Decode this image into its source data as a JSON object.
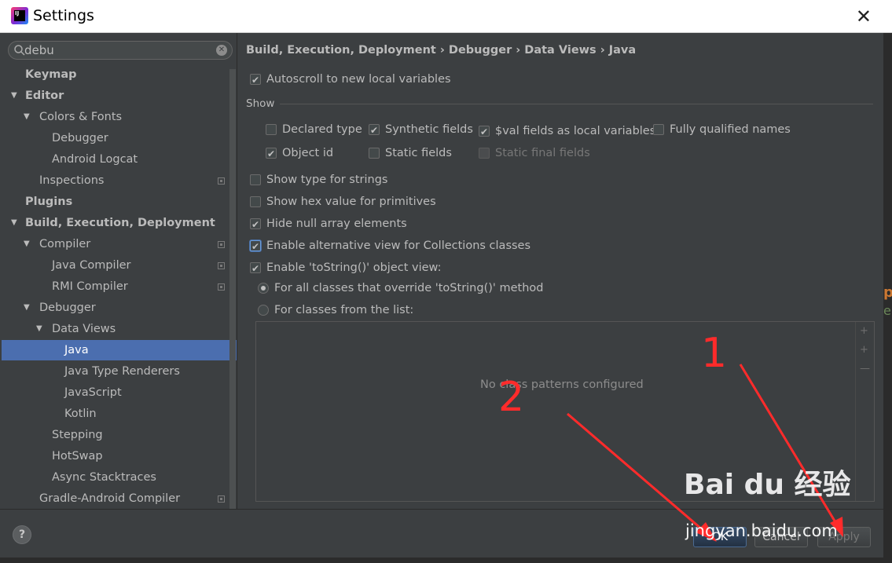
{
  "window": {
    "title": "Settings",
    "close_glyph": "✕",
    "app_icon_text": "IJ"
  },
  "search": {
    "value": "debu"
  },
  "tree": [
    {
      "label": "Keymap",
      "bold": true,
      "arrow": "",
      "level": 0
    },
    {
      "label": "Editor",
      "bold": true,
      "arrow": "▼",
      "level": 0
    },
    {
      "label": "Colors & Fonts",
      "arrow": "▼",
      "level": 1
    },
    {
      "label": "Debugger",
      "arrow": "",
      "level": 2
    },
    {
      "label": "Android Logcat",
      "arrow": "",
      "level": 2
    },
    {
      "label": "Inspections",
      "arrow": "",
      "level": 1,
      "proj": true
    },
    {
      "label": "Plugins",
      "bold": true,
      "arrow": "",
      "level": 0
    },
    {
      "label": "Build, Execution, Deployment",
      "bold": true,
      "arrow": "▼",
      "level": 0
    },
    {
      "label": "Compiler",
      "arrow": "▼",
      "level": 1,
      "proj": true
    },
    {
      "label": "Java Compiler",
      "arrow": "",
      "level": 2,
      "proj": true
    },
    {
      "label": "RMI Compiler",
      "arrow": "",
      "level": 2,
      "proj": true
    },
    {
      "label": "Debugger",
      "arrow": "▼",
      "level": 1
    },
    {
      "label": "Data Views",
      "arrow": "▼",
      "level": 2
    },
    {
      "label": "Java",
      "arrow": "",
      "level": 3,
      "selected": true
    },
    {
      "label": "Java Type Renderers",
      "arrow": "",
      "level": 3
    },
    {
      "label": "JavaScript",
      "arrow": "",
      "level": 3
    },
    {
      "label": "Kotlin",
      "arrow": "",
      "level": 3
    },
    {
      "label": "Stepping",
      "arrow": "",
      "level": 2
    },
    {
      "label": "HotSwap",
      "arrow": "",
      "level": 2
    },
    {
      "label": "Async Stacktraces",
      "arrow": "",
      "level": 2
    },
    {
      "label": "Gradle-Android Compiler",
      "arrow": "",
      "level": 1,
      "proj": true
    }
  ],
  "breadcrumb": "Build, Execution, Deployment › Debugger › Data Views › Java",
  "options": {
    "autoscroll": {
      "label": "Autoscroll to new local variables",
      "checked": true
    },
    "show_section": "Show",
    "declared_type": {
      "label": "Declared type",
      "checked": false
    },
    "synthetic_fields": {
      "label": "Synthetic fields",
      "checked": true
    },
    "val_fields": {
      "label": "$val fields as local variables",
      "checked": true
    },
    "fully_qualified": {
      "label": "Fully qualified names",
      "checked": false
    },
    "object_id": {
      "label": "Object id",
      "checked": true
    },
    "static_fields": {
      "label": "Static fields",
      "checked": false
    },
    "static_final": {
      "label": "Static final fields",
      "checked": false,
      "disabled": true
    },
    "type_strings": {
      "label": "Show type for strings",
      "checked": false
    },
    "hex_value": {
      "label": "Show hex value for primitives",
      "checked": false
    },
    "hide_null": {
      "label": "Hide null array elements",
      "checked": true
    },
    "alt_view": {
      "label": "Enable alternative view for Collections classes",
      "checked": true
    },
    "tostring": {
      "label": "Enable 'toString()' object view:",
      "checked": true
    },
    "radio_all": {
      "label": "For all classes that override 'toString()' method",
      "checked": true
    },
    "radio_list": {
      "label": "For classes from the list:",
      "checked": false
    }
  },
  "list_panel": {
    "empty_text": "No class patterns configured"
  },
  "buttons": {
    "help": "?",
    "ok": "OK",
    "cancel": "Cancel",
    "apply": "Apply"
  },
  "annotations": {
    "one": "1",
    "two": "2",
    "color": "#ff2b2b"
  },
  "watermark": {
    "brand": "Bai du 经验",
    "url": "jingyan.baidu.com"
  },
  "colors": {
    "selection": "#4b6eaf",
    "panel": "#3c3f41",
    "editor": "#2b2b2b"
  }
}
